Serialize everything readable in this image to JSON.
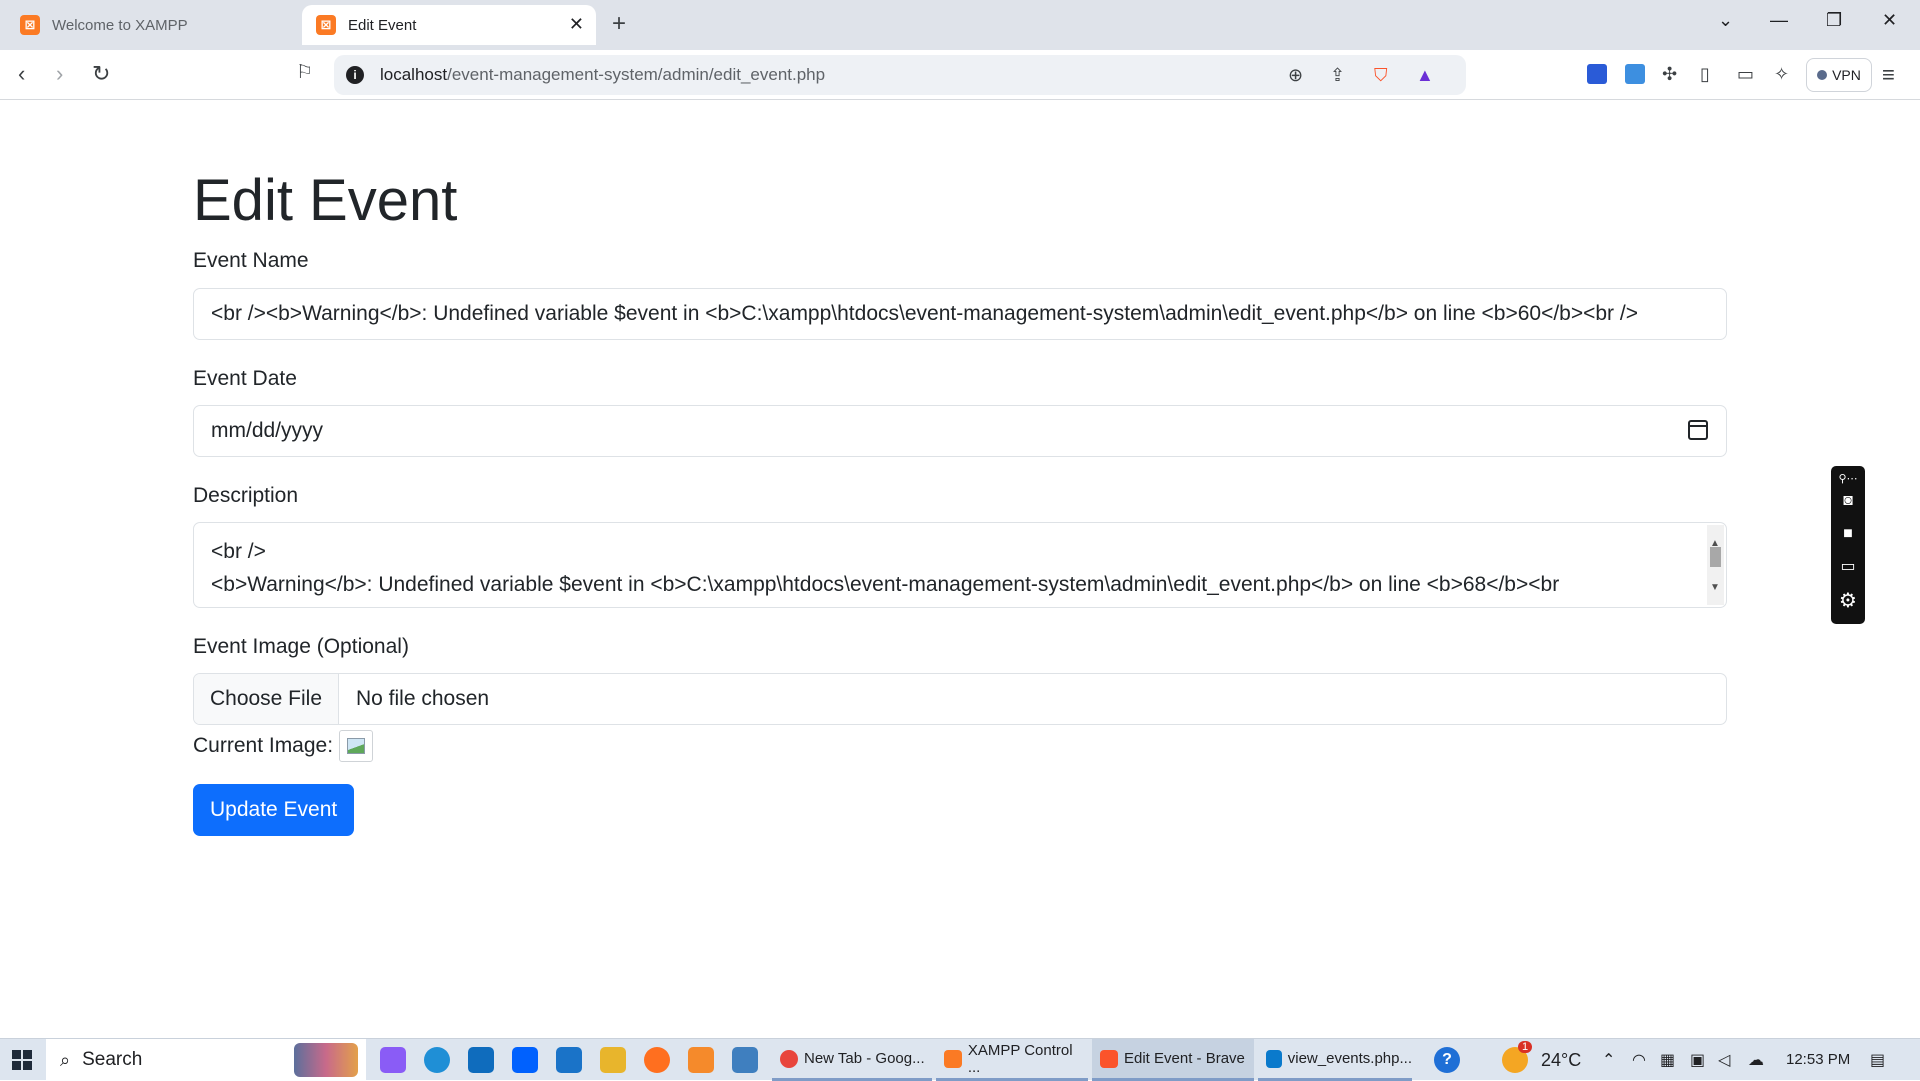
{
  "browser": {
    "tabs": [
      {
        "label": "Welcome to XAMPP",
        "favicon": "xampp-icon",
        "active": false
      },
      {
        "label": "Edit Event",
        "favicon": "xampp-icon",
        "active": true
      }
    ],
    "close_glyph": "✕",
    "new_tab_glyph": "+",
    "url_host": "localhost",
    "url_path": "/event-management-system/admin/edit_event.php",
    "vpn_label": "VPN",
    "accent": "#0d6efd"
  },
  "page": {
    "title": "Edit Event",
    "event_name": {
      "label": "Event Name",
      "value": "<br /><b>Warning</b>:  Undefined variable $event in <b>C:\\xampp\\htdocs\\event-management-system\\admin\\edit_event.php</b> on line <b>60</b><br />"
    },
    "event_date": {
      "label": "Event Date",
      "placeholder": "mm/dd/yyyy"
    },
    "description": {
      "label": "Description",
      "line1": "<br />",
      "line2": "<b>Warning</b>:  Undefined variable $event in <b>C:\\xampp\\htdocs\\event-management-system\\admin\\edit_event.php</b> on line <b>68</b><br"
    },
    "event_image": {
      "label": "Event Image (Optional)",
      "button": "Choose File",
      "status": "No file chosen"
    },
    "current_image_label": "Current Image:",
    "submit_label": "Update Event"
  },
  "taskbar": {
    "search_label": "Search",
    "windows": [
      {
        "label": "New Tab - Goog...",
        "icon": "chrome-icon"
      },
      {
        "label": "XAMPP Control ...",
        "icon": "xampp-icon"
      },
      {
        "label": "Edit Event - Brave",
        "icon": "brave-icon",
        "active": true
      },
      {
        "label": "view_events.php...",
        "icon": "vscode-icon"
      }
    ],
    "temperature": "24°C",
    "weather_badge": "1",
    "clock": "12:53 PM"
  }
}
